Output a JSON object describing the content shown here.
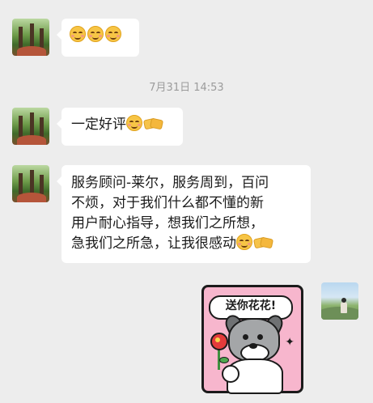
{
  "messages": [
    {
      "sender": "other",
      "text": "",
      "emojis": [
        "smile-emoji",
        "smile-emoji",
        "smile-emoji"
      ]
    },
    {
      "sender": "other",
      "text": "一定好评",
      "emojis": [
        "smile-emoji",
        "handshake-emoji"
      ]
    },
    {
      "sender": "other",
      "lines": [
        "服务顾问-莱尔，服务周到，百问",
        "不烦，对于我们什么都不懂的新",
        "用户耐心指导，想我们之所想，",
        "急我们之所急，让我很感动"
      ],
      "emojis": [
        "smile-emoji",
        "handshake-emoji"
      ]
    }
  ],
  "timestamp": "7月31日 14:53",
  "sticker": {
    "caption": "送你花花!",
    "icon": "dog-holding-flower-sticker"
  },
  "colors": {
    "background": "#ededed",
    "bubble": "#ffffff",
    "timestamp": "#9b9b9b",
    "sticker_bg": "#f7b6cd"
  }
}
